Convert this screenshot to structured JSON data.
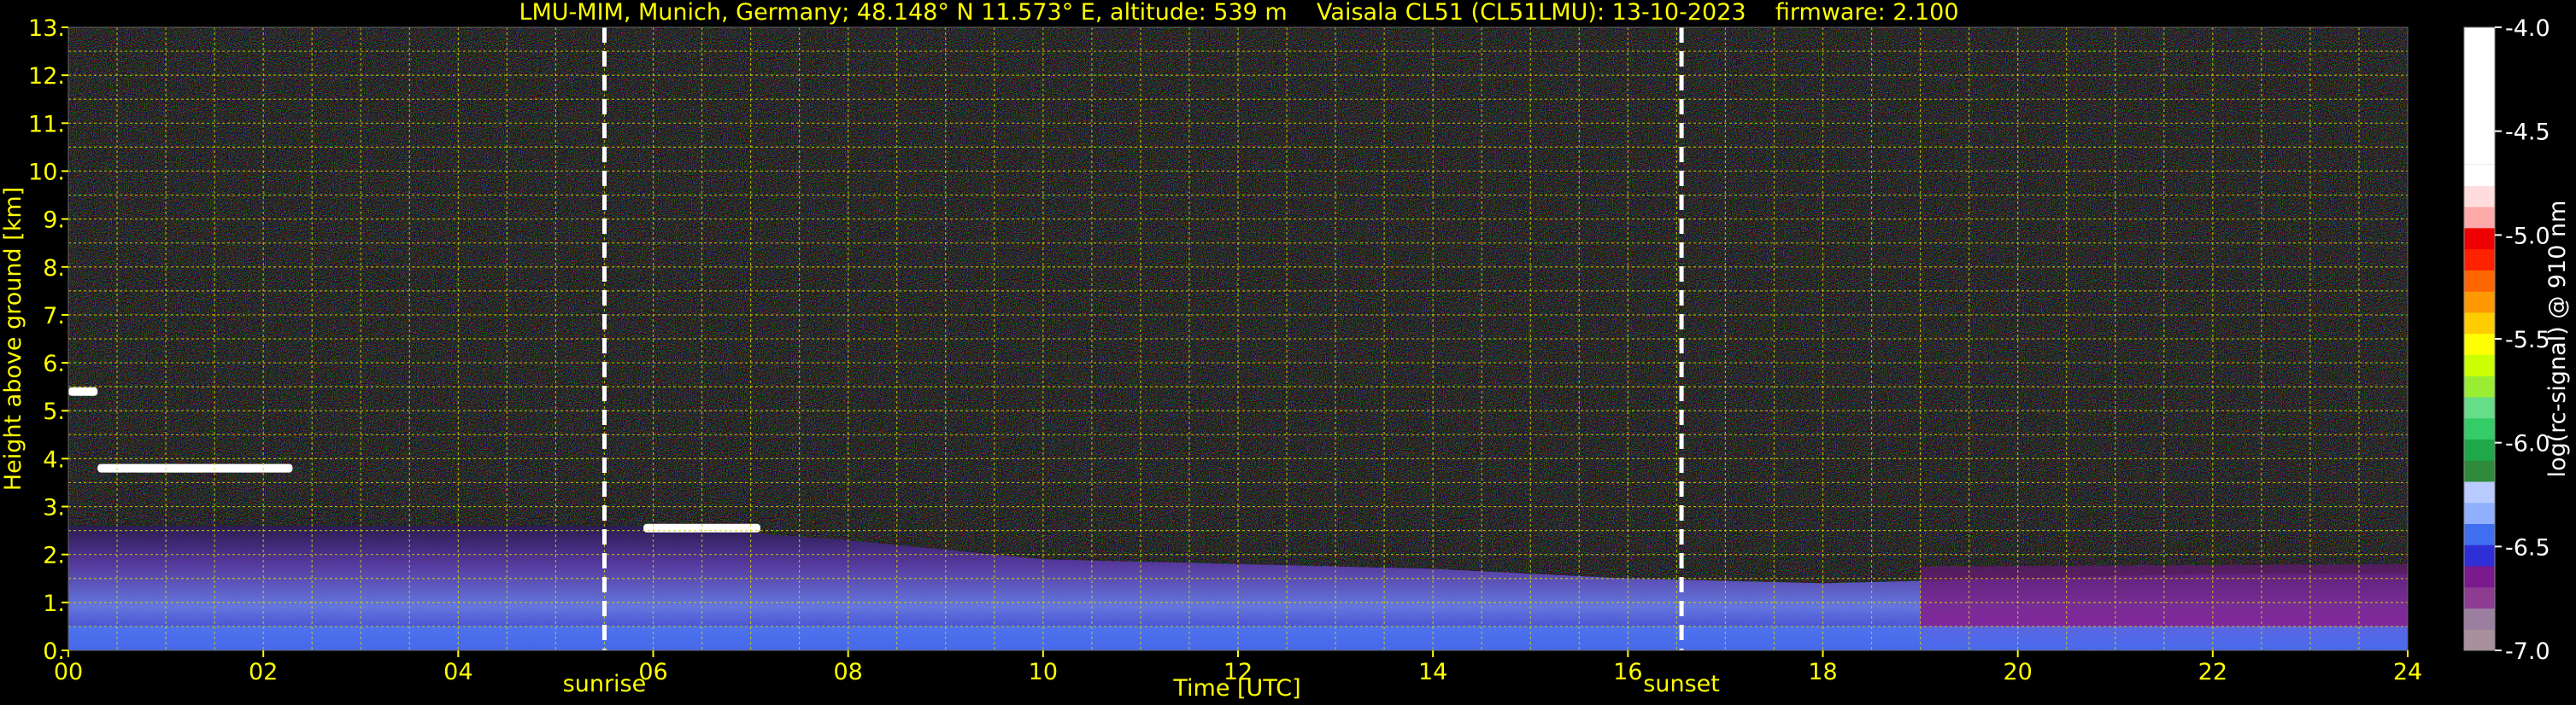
{
  "chart_data": {
    "type": "heatmap",
    "title": "LMU-MIM, Munich, Germany; 48.148° N 11.573° E, altitude: 539 m    Vaisala CL51 (CL51LMU): 13-10-2023    firmware: 2.100",
    "xlabel": "Time [UTC]",
    "ylabel": "Height above ground [km]",
    "xlim": [
      0,
      24
    ],
    "ylim": [
      0,
      13
    ],
    "x_ticks": [
      0,
      2,
      4,
      6,
      8,
      10,
      12,
      14,
      16,
      18,
      20,
      22,
      24
    ],
    "x_tick_labels": [
      "00",
      "02",
      "04",
      "06",
      "08",
      "10",
      "12",
      "14",
      "16",
      "18",
      "20",
      "22",
      "24"
    ],
    "y_ticks": [
      0,
      1,
      2,
      3,
      4,
      5,
      6,
      7,
      8,
      9,
      10,
      11,
      12,
      13
    ],
    "y_tick_labels": [
      "0.",
      "1.",
      "2.",
      "3.",
      "4.",
      "5.",
      "6.",
      "7.",
      "8.",
      "9.",
      "10.",
      "11.",
      "12.",
      "13."
    ],
    "grid": true,
    "colorbar": {
      "label": "log(rc-signal) @ 910 nm",
      "range": [
        -7.0,
        -4.0
      ],
      "ticks": [
        -4.0,
        -4.5,
        -5.0,
        -5.5,
        -6.0,
        -6.5,
        -7.0
      ],
      "tick_labels": [
        "-4.0",
        "-4.5",
        "-5.0",
        "-5.5",
        "-6.0",
        "-6.5",
        "-7.0"
      ],
      "colors": [
        "#a8909c",
        "#9b7fa0",
        "#8e3b92",
        "#7a1a8c",
        "#2f2fd8",
        "#3f6ff0",
        "#8fb0ff",
        "#b9cbff",
        "#2e8b3a",
        "#1fa84a",
        "#33cc66",
        "#66dd88",
        "#99ee33",
        "#ccff00",
        "#ffff00",
        "#ffcc00",
        "#ff9900",
        "#ff6600",
        "#ff2200",
        "#ee0000",
        "#ffaaaa",
        "#ffdddd",
        "#ffffff"
      ]
    },
    "events": [
      {
        "label": "sunrise",
        "time": 5.5
      },
      {
        "label": "sunset",
        "time": 16.55
      }
    ],
    "boundary_layer": {
      "time": [
        0,
        2,
        4,
        6,
        8,
        10,
        12,
        14,
        16,
        18,
        20,
        22,
        24
      ],
      "height": [
        2.6,
        2.6,
        2.6,
        2.6,
        2.3,
        1.9,
        1.8,
        1.7,
        1.5,
        1.4,
        1.5,
        1.6,
        1.6
      ]
    },
    "cloud_layers": [
      {
        "t_start": 0.0,
        "t_end": 0.3,
        "height": 5.4
      },
      {
        "t_start": 0.3,
        "t_end": 2.3,
        "height": 3.8
      },
      {
        "t_start": 5.9,
        "t_end": 7.1,
        "height": 2.55
      }
    ]
  }
}
